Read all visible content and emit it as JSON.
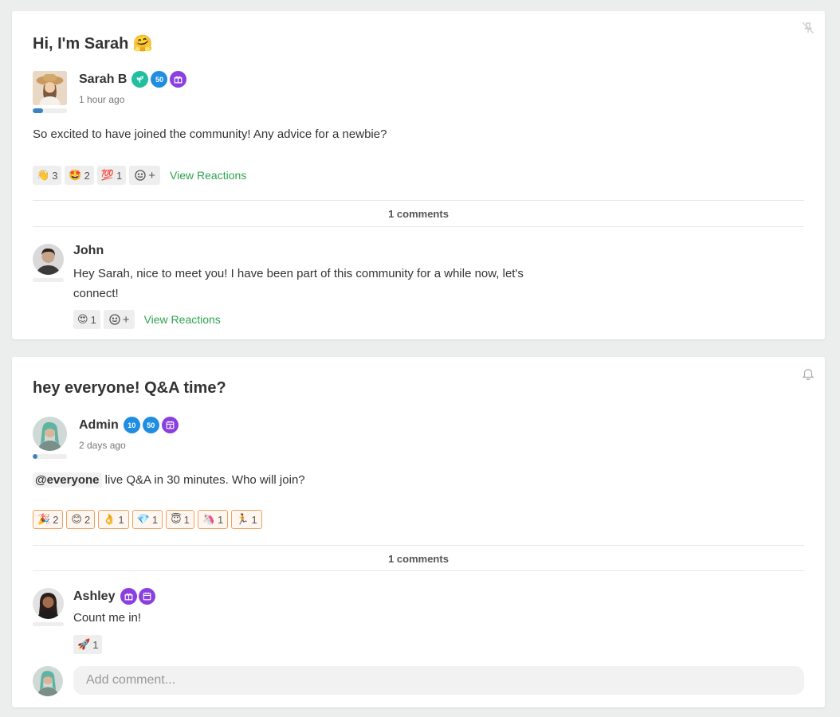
{
  "posts": [
    {
      "title": "Hi, I'm Sarah 🤗",
      "corner_icon": "pin-off-icon",
      "author": {
        "name": "Sarah B",
        "time": "1 hour ago",
        "progress": 0.3,
        "badges": [
          {
            "icon": "sprout-badge",
            "label": "",
            "color": "#1fbf9f"
          },
          {
            "icon": "50-badge",
            "label": "50",
            "color": "#1f8ee0"
          },
          {
            "icon": "gift-badge",
            "label": "🎁",
            "color": "#8a3fe0"
          }
        ]
      },
      "body": "So excited to have joined the community! Any advice for a newbie?",
      "reactions": [
        {
          "emoji": "👋",
          "count": "3"
        },
        {
          "emoji": "🤩",
          "count": "2"
        },
        {
          "emoji": "💯",
          "count": "1"
        }
      ],
      "view_reactions": "View Reactions",
      "comments_label": "1 comments",
      "comment": {
        "name": "John",
        "text": "Hey Sarah, nice to meet you! I have been part of this community for a while now, let's connect!",
        "reactions": [
          {
            "emoji": "😍",
            "count": "1"
          }
        ],
        "view_reactions": "View Reactions"
      }
    },
    {
      "title": "hey everyone! Q&A time?",
      "corner_icon": "bell-icon",
      "author": {
        "name": "Admin",
        "time": "2 days ago",
        "progress": 0.15,
        "badges": [
          {
            "icon": "10-badge",
            "label": "10",
            "color": "#1f8ee0"
          },
          {
            "icon": "50-badge",
            "label": "50",
            "color": "#1f8ee0"
          },
          {
            "icon": "calendar-badge",
            "label": "3",
            "color": "#8a3fe0"
          }
        ]
      },
      "mention": "@everyone",
      "body": " live Q&A in 30 minutes. Who will join?",
      "reactions": [
        {
          "emoji": "🎉",
          "count": "2"
        },
        {
          "emoji": "😊",
          "count": "2"
        },
        {
          "emoji": "👌",
          "count": "1"
        },
        {
          "emoji": "💎",
          "count": "1"
        },
        {
          "emoji": "😇",
          "count": "1"
        },
        {
          "emoji": "🦄",
          "count": "1"
        },
        {
          "emoji": "🏃",
          "count": "1"
        }
      ],
      "comments_label": "1 comments",
      "comment": {
        "name": "Ashley",
        "text": "Count me in!",
        "reactions": [
          {
            "emoji": "🚀",
            "count": "1"
          }
        ]
      },
      "add_comment_placeholder": "Add comment..."
    }
  ]
}
